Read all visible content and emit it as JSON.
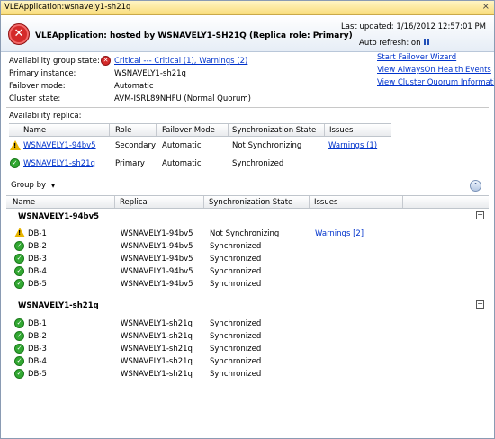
{
  "tab": {
    "title": "VLEApplication:wsnavely1-sh21q",
    "close": "×"
  },
  "header": {
    "title": "VLEApplication: hosted by WSNAVELY1-SH21Q (Replica role: Primary)",
    "last_updated": "Last updated: 1/16/2012 12:57:01 PM",
    "auto_refresh": "Auto refresh: on"
  },
  "summary": {
    "ag_state_label": "Availability group state:",
    "ag_state_value": "Critical --- Critical (1), Warnings (2)",
    "primary_label": "Primary instance:",
    "primary_value": "WSNAVELY1-sh21q",
    "failover_label": "Failover mode:",
    "failover_value": "Automatic",
    "cluster_label": "Cluster state:",
    "cluster_value": "AVM-ISRL89NHFU (Normal Quorum)"
  },
  "links": {
    "start_failover": "Start Failover Wizard",
    "view_health": "View AlwaysOn Health Events",
    "view_quorum": "View Cluster Quorum Information"
  },
  "replicas": {
    "section_label": "Availability replica:",
    "headers": [
      "Name",
      "Role",
      "Failover Mode",
      "Synchronization State",
      "Issues"
    ],
    "rows": [
      {
        "name": "WSNAVELY1-94bv5",
        "role": "Secondary",
        "failover": "Automatic",
        "sync": "Not Synchronizing",
        "issues": "Warnings (1)",
        "status": "warning"
      },
      {
        "name": "WSNAVELY1-sh21q",
        "role": "Primary",
        "failover": "Automatic",
        "sync": "Synchronized",
        "issues": "",
        "status": "ok"
      }
    ]
  },
  "databases": {
    "group_by": "Group by",
    "headers": [
      "Name",
      "Replica",
      "Synchronization State",
      "Issues"
    ],
    "groups": [
      {
        "name": "WSNAVELY1-94bv5",
        "rows": [
          {
            "name": "DB-1",
            "replica": "WSNAVELY1-94bv5",
            "sync": "Not Synchronizing",
            "issues": "Warnings [2]",
            "status": "warning"
          },
          {
            "name": "DB-2",
            "replica": "WSNAVELY1-94bv5",
            "sync": "Synchronized",
            "issues": "",
            "status": "ok"
          },
          {
            "name": "DB-3",
            "replica": "WSNAVELY1-94bv5",
            "sync": "Synchronized",
            "issues": "",
            "status": "ok"
          },
          {
            "name": "DB-4",
            "replica": "WSNAVELY1-94bv5",
            "sync": "Synchronized",
            "issues": "",
            "status": "ok"
          },
          {
            "name": "DB-5",
            "replica": "WSNAVELY1-94bv5",
            "sync": "Synchronized",
            "issues": "",
            "status": "ok"
          }
        ]
      },
      {
        "name": "WSNAVELY1-sh21q",
        "rows": [
          {
            "name": "DB-1",
            "replica": "WSNAVELY1-sh21q",
            "sync": "Synchronized",
            "issues": "",
            "status": "ok"
          },
          {
            "name": "DB-2",
            "replica": "WSNAVELY1-sh21q",
            "sync": "Synchronized",
            "issues": "",
            "status": "ok"
          },
          {
            "name": "DB-3",
            "replica": "WSNAVELY1-sh21q",
            "sync": "Synchronized",
            "issues": "",
            "status": "ok"
          },
          {
            "name": "DB-4",
            "replica": "WSNAVELY1-sh21q",
            "sync": "Synchronized",
            "issues": "",
            "status": "ok"
          },
          {
            "name": "DB-5",
            "replica": "WSNAVELY1-sh21q",
            "sync": "Synchronized",
            "issues": "",
            "status": "ok"
          }
        ]
      }
    ]
  },
  "colors": {
    "link": "#0033cc",
    "ok": "#32a832",
    "error": "#d42a2a",
    "warning": "#e8b500",
    "tab": "#f9dd7c"
  }
}
